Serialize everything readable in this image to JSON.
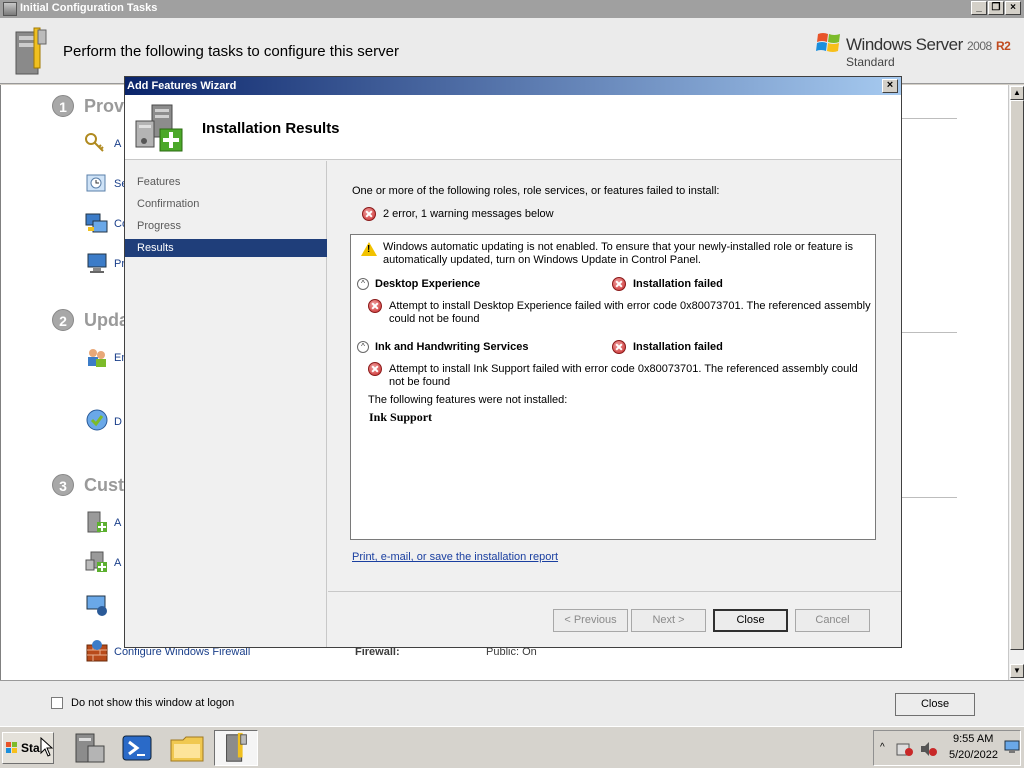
{
  "outer_window": {
    "title": "Initial Configuration Tasks",
    "heading": "Perform the following tasks to configure this server",
    "logo": {
      "brand": "Windows Server",
      "version": "2008",
      "release": "R2",
      "edition": "Standard"
    },
    "sections": [
      {
        "number": "1",
        "title": "Provi"
      },
      {
        "number": "2",
        "title": "Upda"
      },
      {
        "number": "3",
        "title": "Custo"
      }
    ],
    "tasks": [
      "A",
      "Se",
      "Co",
      "Pr",
      "En",
      "D",
      "A",
      "A",
      "",
      "Configure Windows Firewall"
    ],
    "firewall": {
      "label": "Firewall:",
      "value": "Public: On"
    },
    "footer": {
      "checkbox_label": "Do not show this window at logon",
      "close_label": "Close"
    }
  },
  "dialog": {
    "title": "Add Features Wizard",
    "header_title": "Installation Results",
    "nav": [
      "Features",
      "Confirmation",
      "Progress",
      "Results"
    ],
    "active_nav": "Results",
    "intro": "One or more of the following roles, role services, or features failed to install:",
    "summary": "2 error, 1 warning messages below",
    "warning": "Windows automatic updating is not enabled. To ensure that your newly-installed role or feature is automatically updated, turn on Windows Update in Control Panel.",
    "results": [
      {
        "name": "Desktop Experience",
        "status": "Installation failed",
        "message_line1": "Attempt to install Desktop Experience failed with error code 0x80073701.  The referenced assembly",
        "message_line2": "could not be found"
      },
      {
        "name": "Ink and Handwriting Services",
        "status": "Installation failed",
        "message_line1": "Attempt to install Ink Support failed with error code 0x80073701.  The referenced assembly could",
        "message_line2": "not be found"
      }
    ],
    "not_installed_label": "The following features were not installed:",
    "not_installed_item": "Ink Support",
    "report_link": "Print, e-mail, or save the installation report",
    "buttons": {
      "previous": "< Previous",
      "next": "Next >",
      "close": "Close",
      "cancel": "Cancel"
    }
  },
  "taskbar": {
    "start_label": "Start",
    "clock_time": "9:55 AM",
    "clock_date": "5/20/2022"
  }
}
